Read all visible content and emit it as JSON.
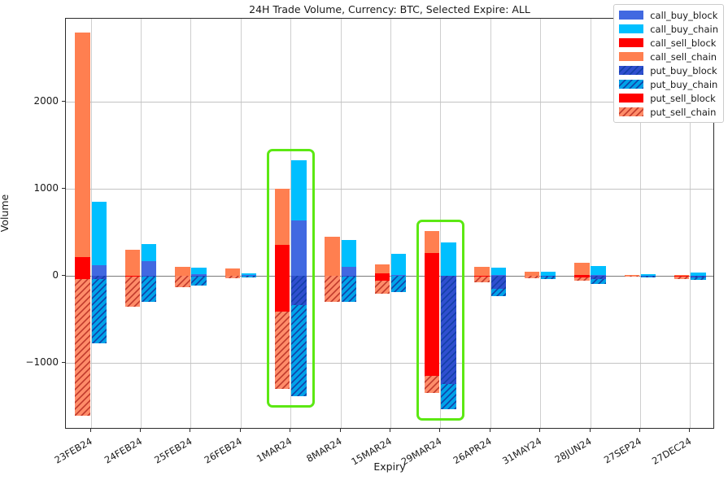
{
  "chart_data": {
    "type": "bar",
    "title": "24H Trade Volume, Currency: BTC, Selected Expire: ALL",
    "xlabel": "Expiry",
    "ylabel": "Volume",
    "ylim": [
      -1770,
      2960
    ],
    "yticks": [
      2000,
      1000,
      0,
      -1000
    ],
    "ytick_labels": [
      "2000",
      "1000",
      "0",
      "−1000"
    ],
    "grid": true,
    "legend_position": "upper right",
    "stacked": true,
    "bar_groups": "two bars per expiry: left = sell (call_sell_chain + call_sell_block above zero, put_sell_block + put_sell_chain below zero), right = buy (call_buy_chain + call_buy_block above zero, put_buy_block + put_buy_chain below zero)",
    "categories": [
      "23FEB24",
      "24FEB24",
      "25FEB24",
      "26FEB24",
      "1MAR24",
      "8MAR24",
      "15MAR24",
      "29MAR24",
      "26APR24",
      "31MAY24",
      "28JUN24",
      "27SEP24",
      "27DEC24"
    ],
    "categories_full": [
      "23FEB24",
      "24FEB24",
      "25FEB24",
      "26FEB24",
      "1MAR24",
      "8MAR24",
      "15MAR24",
      "29MAR24",
      "26APR24",
      "31MAY24",
      "28JUN24",
      "27SEP24",
      "27DEC24"
    ],
    "series": [
      {
        "name": "call_buy_block",
        "color": "#4169E1",
        "hatch": "none",
        "sign": "positive",
        "bar": "right",
        "values": [
          120,
          170,
          20,
          5,
          640,
          105,
          12,
          0,
          10,
          3,
          6,
          2,
          4
        ]
      },
      {
        "name": "call_buy_chain",
        "color": "#00BFFF",
        "hatch": "none",
        "sign": "positive",
        "bar": "right",
        "values": [
          735,
          195,
          75,
          22,
          690,
          310,
          245,
          385,
          80,
          40,
          105,
          16,
          38
        ]
      },
      {
        "name": "call_sell_block",
        "color": "#FF0000",
        "hatch": "none",
        "sign": "positive",
        "bar": "left",
        "values": [
          215,
          0,
          0,
          0,
          360,
          0,
          25,
          265,
          0,
          0,
          8,
          0,
          0
        ]
      },
      {
        "name": "call_sell_chain",
        "color": "#FF7F50",
        "hatch": "none",
        "sign": "positive",
        "bar": "left",
        "values": [
          2585,
          300,
          105,
          80,
          645,
          450,
          110,
          255,
          100,
          48,
          140,
          14,
          12
        ]
      },
      {
        "name": "put_buy_block",
        "color": "#2F4FCF",
        "hatch": "diagonal",
        "sign": "negative",
        "bar": "right",
        "values": [
          -35,
          -10,
          -5,
          0,
          -340,
          -6,
          -4,
          -1245,
          -150,
          -8,
          -40,
          -5,
          -20
        ]
      },
      {
        "name": "put_buy_chain",
        "color": "#00A2E8",
        "hatch": "diagonal",
        "sign": "negative",
        "bar": "right",
        "values": [
          -745,
          -290,
          -105,
          -20,
          -1050,
          -290,
          -185,
          -290,
          -80,
          -30,
          -55,
          -12,
          -30
        ]
      },
      {
        "name": "put_sell_block",
        "color": "#FF0000",
        "hatch": "none",
        "sign": "negative",
        "bar": "left",
        "values": [
          -40,
          -5,
          -4,
          0,
          -415,
          -4,
          -55,
          -1150,
          -12,
          -3,
          -15,
          -2,
          -5
        ]
      },
      {
        "name": "put_sell_chain",
        "color": "#FF8C69",
        "hatch": "diagonal",
        "sign": "negative",
        "bar": "left",
        "values": [
          -1575,
          -355,
          -130,
          -30,
          -890,
          -300,
          -150,
          -200,
          -60,
          -25,
          -40,
          -10,
          -35
        ]
      }
    ],
    "annotations": [
      {
        "type": "highlight-box",
        "category": "1MAR24",
        "color": "#5ce813"
      },
      {
        "type": "highlight-box",
        "category": "29MAR24",
        "color": "#5ce813"
      }
    ]
  },
  "legend": {
    "entries": [
      {
        "label": "call_buy_block",
        "color": "#4169E1",
        "hatch": "none"
      },
      {
        "label": "call_buy_chain",
        "color": "#00BFFF",
        "hatch": "none"
      },
      {
        "label": "call_sell_block",
        "color": "#FF0000",
        "hatch": "none"
      },
      {
        "label": "call_sell_chain",
        "color": "#FF7F50",
        "hatch": "none"
      },
      {
        "label": "put_buy_block",
        "color": "#2F4FCF",
        "hatch": "diagonal"
      },
      {
        "label": "put_buy_chain",
        "color": "#00A2E8",
        "hatch": "diagonal"
      },
      {
        "label": "put_sell_block",
        "color": "#FF0000",
        "hatch": "none"
      },
      {
        "label": "put_sell_chain",
        "color": "#FF8C69",
        "hatch": "diagonal"
      }
    ]
  }
}
